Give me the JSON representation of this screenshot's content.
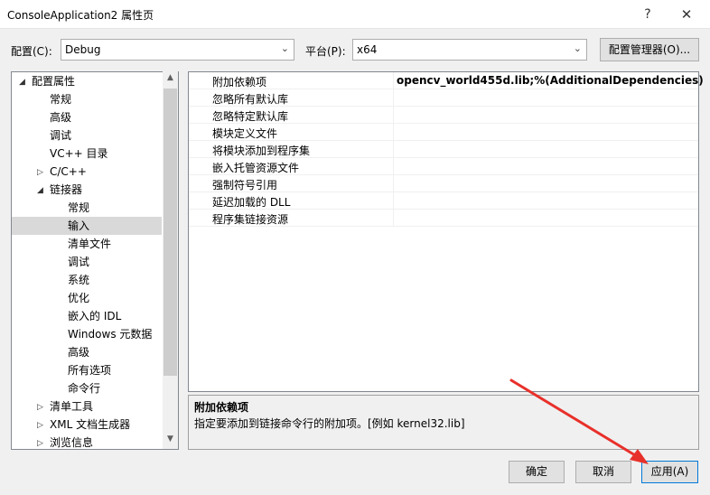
{
  "window": {
    "title": "ConsoleApplication2 属性页",
    "help_glyph": "?",
    "close_glyph": "✕"
  },
  "toolbar": {
    "config_label": "配置(C):",
    "config_value": "Debug",
    "platform_label": "平台(P):",
    "platform_value": "x64",
    "config_manager_label": "配置管理器(O)..."
  },
  "tree": {
    "items": [
      {
        "label": "配置属性",
        "level": 0,
        "twisty": "◢",
        "selected": false
      },
      {
        "label": "常规",
        "level": 1,
        "twisty": "",
        "selected": false
      },
      {
        "label": "高级",
        "level": 1,
        "twisty": "",
        "selected": false
      },
      {
        "label": "调试",
        "level": 1,
        "twisty": "",
        "selected": false
      },
      {
        "label": "VC++ 目录",
        "level": 1,
        "twisty": "",
        "selected": false
      },
      {
        "label": "C/C++",
        "level": 1,
        "twisty": "▷",
        "selected": false
      },
      {
        "label": "链接器",
        "level": 1,
        "twisty": "◢",
        "selected": false
      },
      {
        "label": "常规",
        "level": 2,
        "twisty": "",
        "selected": false
      },
      {
        "label": "输入",
        "level": 2,
        "twisty": "",
        "selected": true
      },
      {
        "label": "清单文件",
        "level": 2,
        "twisty": "",
        "selected": false
      },
      {
        "label": "调试",
        "level": 2,
        "twisty": "",
        "selected": false
      },
      {
        "label": "系统",
        "level": 2,
        "twisty": "",
        "selected": false
      },
      {
        "label": "优化",
        "level": 2,
        "twisty": "",
        "selected": false
      },
      {
        "label": "嵌入的 IDL",
        "level": 2,
        "twisty": "",
        "selected": false
      },
      {
        "label": "Windows 元数据",
        "level": 2,
        "twisty": "",
        "selected": false
      },
      {
        "label": "高级",
        "level": 2,
        "twisty": "",
        "selected": false
      },
      {
        "label": "所有选项",
        "level": 2,
        "twisty": "",
        "selected": false
      },
      {
        "label": "命令行",
        "level": 2,
        "twisty": "",
        "selected": false
      },
      {
        "label": "清单工具",
        "level": 1,
        "twisty": "▷",
        "selected": false
      },
      {
        "label": "XML 文档生成器",
        "level": 1,
        "twisty": "▷",
        "selected": false
      },
      {
        "label": "浏览信息",
        "level": 1,
        "twisty": "▷",
        "selected": false
      }
    ],
    "scroll_up_glyph": "▲",
    "scroll_down_glyph": "▼"
  },
  "grid": {
    "rows": [
      {
        "name": "附加依赖项",
        "value": "opencv_world455d.lib;%(AdditionalDependencies)"
      },
      {
        "name": "忽略所有默认库",
        "value": ""
      },
      {
        "name": "忽略特定默认库",
        "value": ""
      },
      {
        "name": "模块定义文件",
        "value": ""
      },
      {
        "name": "将模块添加到程序集",
        "value": ""
      },
      {
        "name": "嵌入托管资源文件",
        "value": ""
      },
      {
        "name": "强制符号引用",
        "value": ""
      },
      {
        "name": "延迟加载的 DLL",
        "value": ""
      },
      {
        "name": "程序集链接资源",
        "value": ""
      }
    ]
  },
  "description": {
    "title": "附加依赖项",
    "text": "指定要添加到链接命令行的附加项。[例如 kernel32.lib]"
  },
  "footer": {
    "ok_label": "确定",
    "cancel_label": "取消",
    "apply_label": "应用(A)"
  },
  "annotation": {
    "arrow_color": "#e8302a"
  }
}
